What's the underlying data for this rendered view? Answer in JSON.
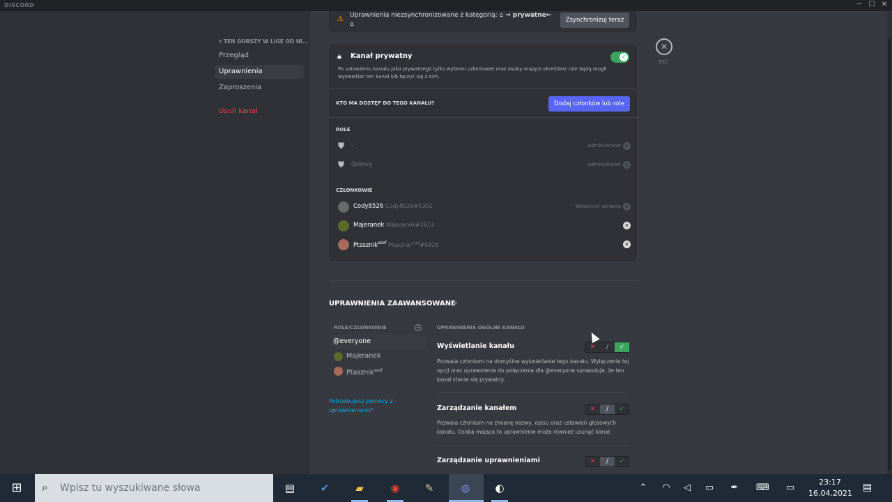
{
  "window": {
    "app_name": "DISCORD",
    "minimize": "─",
    "maximize": "☐",
    "close": "✕"
  },
  "sidebar": {
    "category": "TEN GORSZY W LIGE OD NI...",
    "items": [
      {
        "label": "Przegląd"
      },
      {
        "label": "Uprawnienia"
      },
      {
        "label": "Zaproszenia"
      },
      {
        "label": "Usuń kanał"
      }
    ]
  },
  "sync": {
    "text_before": "Uprawnienia niezsynchronizowane z kategorią:",
    "category": "→ prywatne←",
    "button": "Zsynchronizuj teraz"
  },
  "private": {
    "title": "Kanał prywatny",
    "description": "Po ustawieniu kanału jako prywatnego tylko wybrani członkowie oraz osoby mające określone role będą mogli wyświetlać ten kanał lub łączyć się z nim.",
    "enabled": true
  },
  "access": {
    "heading": "KTO MA DOSTĘP DO TEGO KANAŁU?",
    "add_button": "Dodaj członków lub role"
  },
  "roles": {
    "heading": "ROLE",
    "items": [
      {
        "name": "-",
        "tag": "Administrator"
      },
      {
        "name": "Groovy",
        "tag": "Administrator"
      }
    ]
  },
  "members": {
    "heading": "CZŁONKOWIE",
    "items": [
      {
        "name": "Cody8526",
        "tag": "Cody8526#5301",
        "suffix": "",
        "tag_suffix": "",
        "badge": "Właściciel serwera"
      },
      {
        "name": "Majeranek",
        "tag": "Majeranek#1613",
        "suffix": "",
        "tag_suffix": "",
        "badge": ""
      },
      {
        "name": "Ptasznik",
        "tag": "Ptasznik",
        "suffix": "szef",
        "tag_suffix": "#5928",
        "badge": ""
      }
    ]
  },
  "esc": {
    "icon": "✕",
    "label": "ESC"
  },
  "advanced": {
    "title": "UPRAWNIENIA ZAAWANSOWANE",
    "roles_heading": "ROLE/CZŁONKOWIE",
    "list": [
      {
        "label": "@everyone"
      },
      {
        "label": "Majeranek"
      },
      {
        "label": "Ptasznik",
        "suffix": "szef"
      }
    ],
    "help": "Potrzebujesz pomocy z uprawnieniami?",
    "perm_heading": "UPRAWNIENIA OGÓLNE KANAŁU",
    "permissions": [
      {
        "title": "Wyświetlanie kanału",
        "description": "Pozwala członkom na domyślne wyświetlanie tego kanału. Wyłączenie tej opcji oraz uprawnienia do połączenia dla @everyone spowoduje, że ten kanał stanie się prywatny.",
        "state": "allow"
      },
      {
        "title": "Zarządzanie kanałem",
        "description": "Pozwala członkom na zmianę nazwy, opisu oraz ustawień głosowych kanału. Osoba mająca to uprawnienie może również usunąć kanał.",
        "state": "neutral"
      },
      {
        "title": "Zarządzanie uprawnieniami",
        "description": "",
        "state": "neutral"
      }
    ],
    "tri_symbols": {
      "deny": "✕",
      "neutral": "/",
      "allow": "✓"
    }
  },
  "taskbar": {
    "search_placeholder": "Wpisz tu wyszukiwane słowa",
    "time": "23:17",
    "date": "16.04.2021"
  },
  "colors": {
    "accent": "#5865f2",
    "success": "#3ba55d",
    "danger": "#ed4245",
    "link": "#00aff4"
  }
}
